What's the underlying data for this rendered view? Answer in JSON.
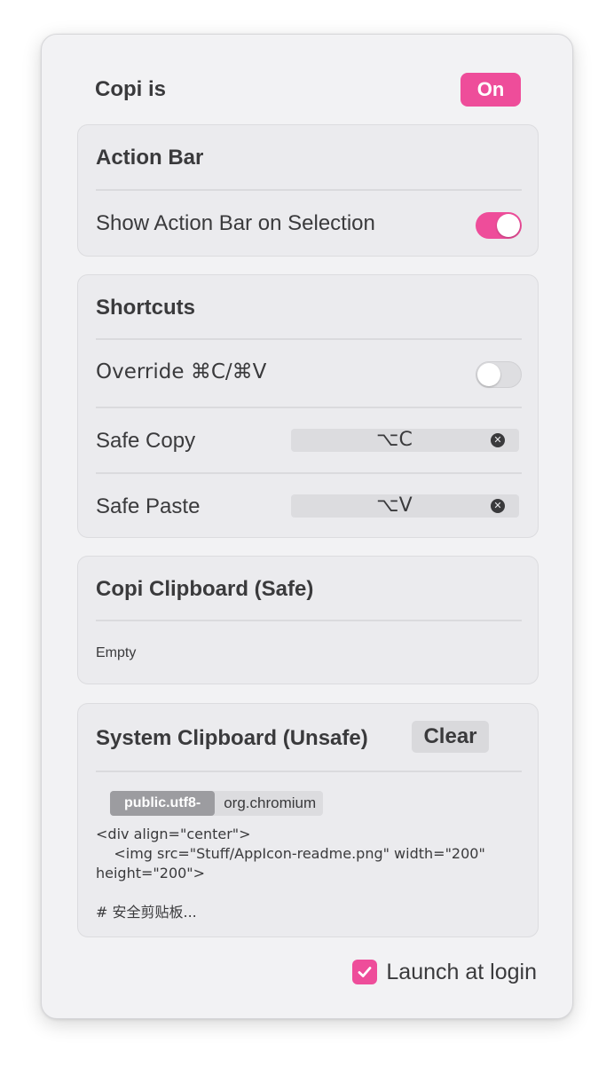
{
  "header": {
    "title": "Copi is",
    "status_badge": "On"
  },
  "action_bar": {
    "title": "Action Bar",
    "show_on_selection_label": "Show Action Bar on Selection",
    "show_on_selection_enabled": true
  },
  "shortcuts": {
    "title": "Shortcuts",
    "override_label": "Override ⌘C/⌘V",
    "override_enabled": false,
    "safe_copy_label": "Safe Copy",
    "safe_copy_value": "⌥C",
    "safe_paste_label": "Safe Paste",
    "safe_paste_value": "⌥V"
  },
  "copi_clipboard": {
    "title": "Copi Clipboard (Safe)",
    "content": "Empty"
  },
  "system_clipboard": {
    "title": "System Clipboard (Unsafe)",
    "clear_label": "Clear",
    "types": [
      "public.utf8-",
      "org.chromium"
    ],
    "content": "<div align=\"center\">\n    <img src=\"Stuff/AppIcon-readme.png\" width=\"200\" height=\"200\">\n\n# 安全剪贴板..."
  },
  "launch_at_login": {
    "label": "Launch at login",
    "checked": true
  },
  "colors": {
    "accent": "#ee4d9a",
    "panel_background": "#f2f2f4",
    "section_background": "#ebebee"
  },
  "icons": {
    "clear_field": "x-circle-icon",
    "checkbox": "checkmark-icon"
  }
}
